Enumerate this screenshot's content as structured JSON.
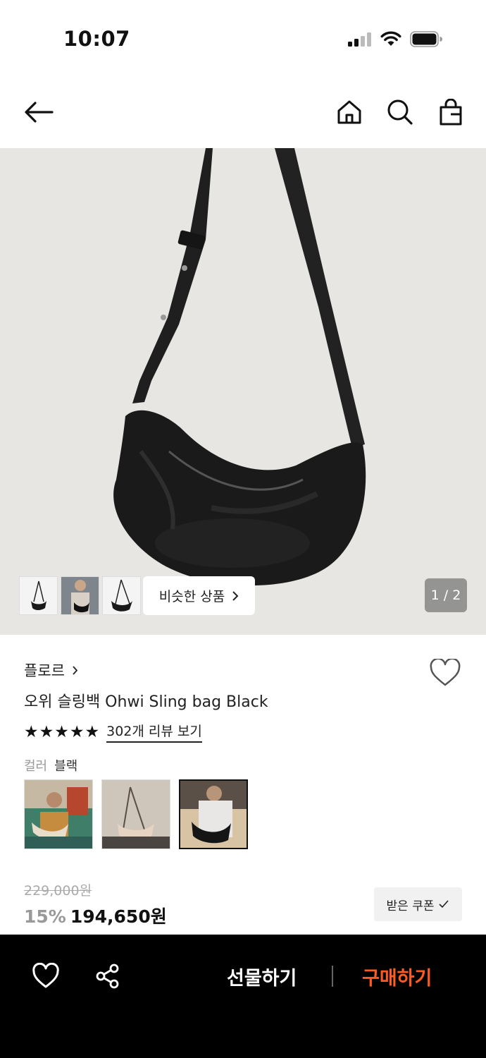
{
  "status_bar": {
    "time": "10:07"
  },
  "product": {
    "page_indicator": "1 / 2",
    "similar_label": "비슷한 상품",
    "brand": "플로르",
    "name": "오위 슬링백 Ohwi Sling bag Black",
    "rating_stars": 5,
    "review_link": "302개 리뷰 보기",
    "color_label": "컬러",
    "color_value": "블랙",
    "original_price": "229,000원",
    "discount": "15%",
    "price": "194,650원",
    "coupon_label": "받은 쿠폰"
  },
  "bottom_bar": {
    "gift_label": "선물하기",
    "buy_label": "구매하기"
  },
  "colors": {
    "accent": "#ff5a1f",
    "bottom_bar_bg": "#000000",
    "hero_bg": "#e8e6e3"
  }
}
